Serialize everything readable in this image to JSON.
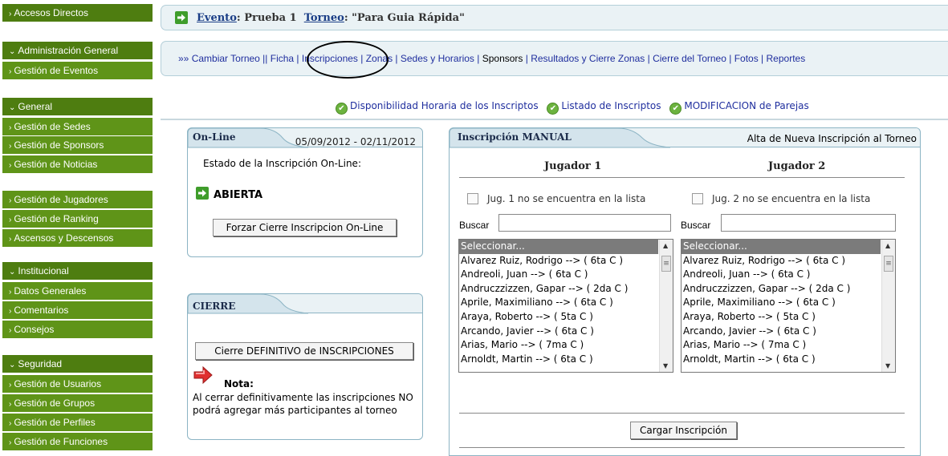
{
  "sidebar": {
    "items": [
      {
        "label": "Accesos Directos",
        "kind": "head",
        "arrow": "›"
      },
      {
        "label": "Administración General",
        "kind": "head",
        "arrow": "⌄"
      },
      {
        "label": "Gestión de Eventos",
        "kind": "item",
        "arrow": "›"
      },
      {
        "label": "General",
        "kind": "head",
        "arrow": "⌄"
      },
      {
        "label": "Gestión de Sedes",
        "kind": "item",
        "arrow": "›"
      },
      {
        "label": "Gestión de Sponsors",
        "kind": "item",
        "arrow": "›"
      },
      {
        "label": "Gestión de Noticias",
        "kind": "item",
        "arrow": "›"
      },
      {
        "label": "Gestión de Jugadores",
        "kind": "item",
        "arrow": "›"
      },
      {
        "label": "Gestión de Ranking",
        "kind": "item",
        "arrow": "›"
      },
      {
        "label": "Ascensos y Descensos",
        "kind": "item",
        "arrow": "›"
      },
      {
        "label": "Institucional",
        "kind": "head",
        "arrow": "⌄"
      },
      {
        "label": "Datos Generales",
        "kind": "item",
        "arrow": "›"
      },
      {
        "label": "Comentarios",
        "kind": "item",
        "arrow": "›"
      },
      {
        "label": "Consejos",
        "kind": "item",
        "arrow": "›"
      },
      {
        "label": "Seguridad",
        "kind": "head",
        "arrow": "⌄"
      },
      {
        "label": "Gestión de Usuarios",
        "kind": "item",
        "arrow": "›"
      },
      {
        "label": "Gestión de Grupos",
        "kind": "item",
        "arrow": "›"
      },
      {
        "label": "Gestión de Perfiles",
        "kind": "item",
        "arrow": "›"
      },
      {
        "label": "Gestión de Funciones",
        "kind": "item",
        "arrow": "›"
      }
    ]
  },
  "breadcrumb": {
    "evento_label": "Evento",
    "evento_value": ": Prueba 1",
    "torneo_label": "Torneo",
    "torneo_value": ": \"Para Guia Rápida\""
  },
  "tabs": {
    "prefix": "»» ",
    "items": [
      {
        "label": "Cambiar Torneo",
        "sep": " || "
      },
      {
        "label": "Ficha",
        "sep": " | "
      },
      {
        "label": "Inscripciones",
        "sep": " | "
      },
      {
        "label": "Zonas",
        "sep": " | "
      },
      {
        "label": "Sedes y Horarios",
        "sep": " | "
      },
      {
        "label": "Sponsors",
        "sep": " | "
      },
      {
        "label": "Resultados y Cierre Zonas",
        "sep": " | "
      },
      {
        "label": "Cierre del Torneo",
        "sep": " | "
      },
      {
        "label": "Fotos",
        "sep": " | "
      },
      {
        "label": "Reportes",
        "sep": ""
      }
    ]
  },
  "links": {
    "disponibilidad": "Disponibilidad Horaria de los Inscriptos",
    "listado": "Listado de Inscriptos",
    "modificacion": "MODIFICACION de Parejas"
  },
  "online": {
    "title": "On-Line",
    "dates": "05/09/2012 - 02/11/2012",
    "state_label": "Estado de la Inscripción On-Line:",
    "state_value": "ABIERTA",
    "force_button": "Forzar Cierre Inscripcion On-Line"
  },
  "cierre": {
    "title": "CIERRE",
    "button": "Cierre DEFINITIVO de INSCRIPCIONES",
    "nota_title": "Nota:",
    "nota_text": "Al cerrar definitivamente las inscripciones NO podrá agregar más participantes al torneo"
  },
  "manual": {
    "title": "Inscripción MANUAL",
    "subtitle": "Alta de Nueva Inscripción al Torneo",
    "jugador1": "Jugador 1",
    "jugador2": "Jugador 2",
    "check1": "Jug. 1 no se encuentra en la lista",
    "check2": "Jug. 2 no se encuentra en la lista",
    "search_label": "Buscar",
    "search1_value": "",
    "search2_value": "",
    "players": [
      "Seleccionar...",
      "Alvarez Ruiz, Rodrigo --> ( 6ta C )",
      "Andreoli, Juan --> ( 6ta C )",
      "Andruczzizzen, Gapar --> ( 2da C )",
      "Aprile, Maximiliano --> ( 6ta C )",
      "Araya, Roberto --> ( 5ta C )",
      "Arcando, Javier --> ( 6ta C )",
      "Arias, Mario --> ( 7ma C )",
      "Arnoldt, Martin --> ( 6ta C )"
    ],
    "submit_button": "Cargar Inscripción"
  },
  "colors": {
    "sidebar_head": "#4e7d10",
    "sidebar_item": "#5f9418",
    "panel_bg": "#eaf2f5",
    "link": "#1f2e9e"
  }
}
